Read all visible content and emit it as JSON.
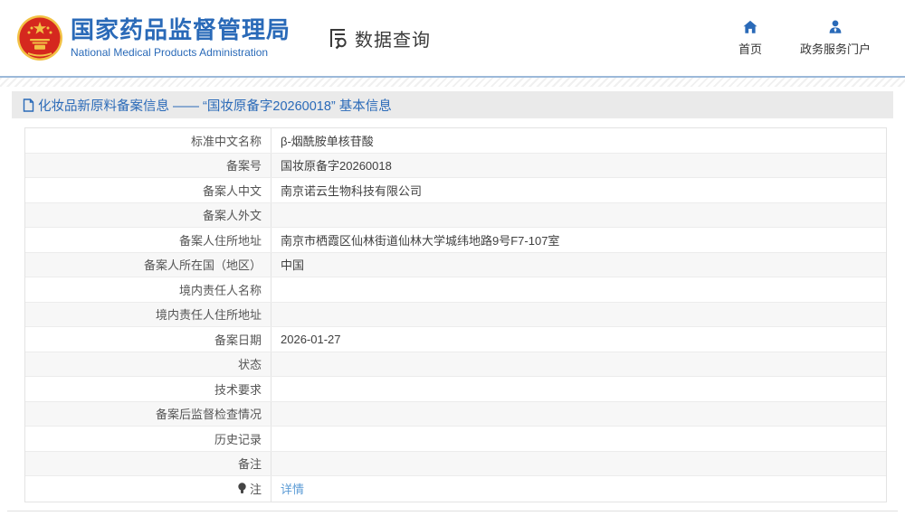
{
  "header": {
    "org_name_zh": "国家药品监督管理局",
    "org_name_en": "National Medical Products Administration",
    "section_label": "数据查询",
    "nav": {
      "home_label": "首页",
      "portal_label": "政务服务门户"
    },
    "icons": {
      "logo": "china-national-emblem",
      "section": "document-search-icon",
      "home": "home-icon",
      "portal": "person-icon"
    }
  },
  "page": {
    "title": "化妆品新原料备案信息 —— “国妆原备字20260018” 基本信息",
    "title_icon": "document-icon"
  },
  "colors": {
    "brand_blue": "#2a6ab8",
    "link_blue": "#5b9bd5",
    "title_bar_bg": "#eaeaea",
    "row_alt_bg": "#f7f7f7",
    "emblem_red": "#d5281e",
    "emblem_gold": "#f2c245"
  },
  "table": {
    "rows": [
      {
        "label": "标准中文名称",
        "value": "β-烟酰胺单核苷酸"
      },
      {
        "label": "备案号",
        "value": "国妆原备字20260018"
      },
      {
        "label": "备案人中文",
        "value": "南京诺云生物科技有限公司"
      },
      {
        "label": "备案人外文",
        "value": ""
      },
      {
        "label": "备案人住所地址",
        "value": "南京市栖霞区仙林街道仙林大学城纬地路9号F7-107室"
      },
      {
        "label": "备案人所在国（地区）",
        "value": "中国"
      },
      {
        "label": "境内责任人名称",
        "value": ""
      },
      {
        "label": "境内责任人住所地址",
        "value": ""
      },
      {
        "label": "备案日期",
        "value": "2026-01-27"
      },
      {
        "label": "状态",
        "value": ""
      },
      {
        "label": "技术要求",
        "value": ""
      },
      {
        "label": "备案后监督检查情况",
        "value": ""
      },
      {
        "label": "历史记录",
        "value": ""
      },
      {
        "label": "备注",
        "value": ""
      },
      {
        "label": "注",
        "value": "详情",
        "value_is_link": true,
        "label_icon": "lightbulb-icon"
      }
    ]
  }
}
